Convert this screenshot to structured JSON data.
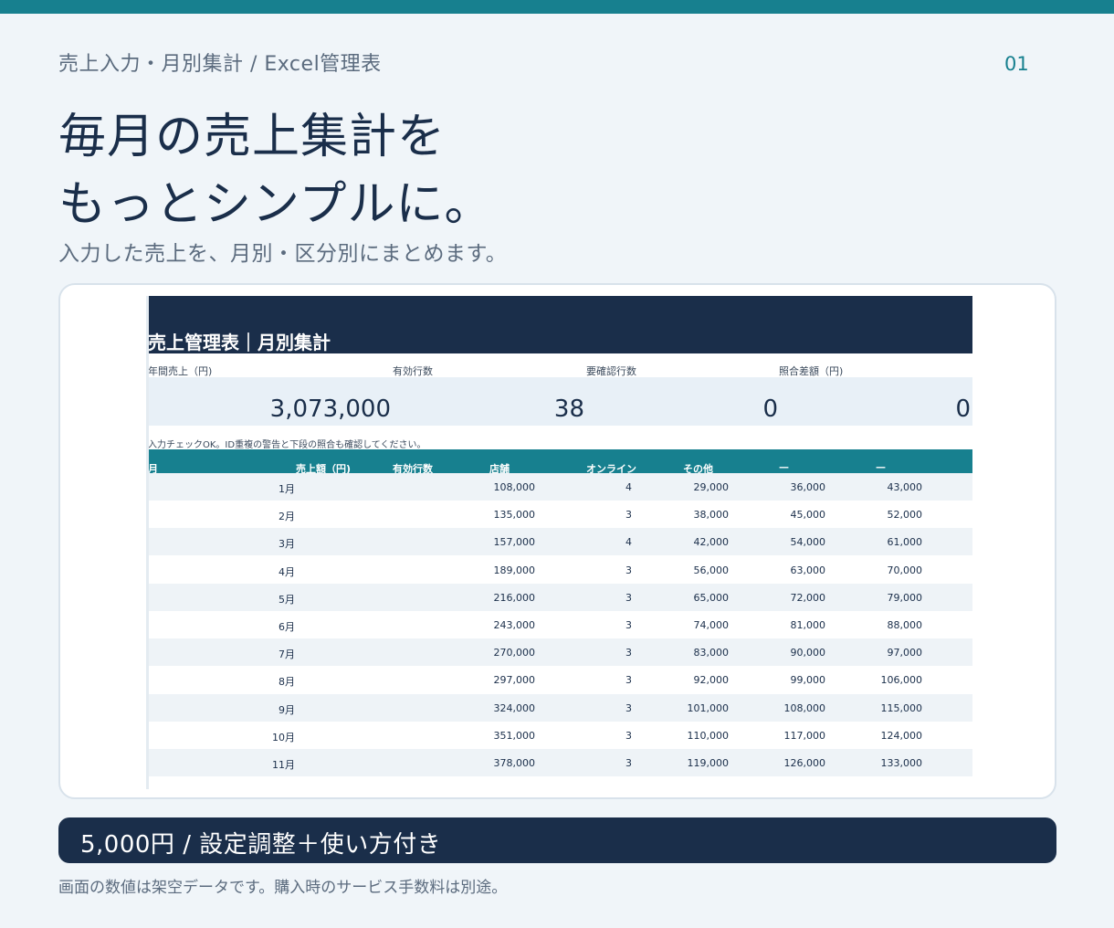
{
  "breadcrumb": "売上入力・月別集計 / Excel管理表",
  "page_number": "01",
  "headline": [
    "毎月の売上集計を",
    "もっとシンプルに。"
  ],
  "subline": "入力した売上を、月別・区分別にまとめます。",
  "sheet": {
    "title": "売上管理表｜月別集計",
    "kpis": [
      {
        "label": "年間売上（円)",
        "value": "3,073,000"
      },
      {
        "label": "有効行数",
        "value": "38"
      },
      {
        "label": "要確認行数",
        "value": "0"
      },
      {
        "label": "照合差額（円)",
        "value": "0"
      }
    ],
    "note": "入力チェックOK。ID重複の警告と下段の照合も確認してください。",
    "columns": [
      "月",
      "売上額（円)",
      "有効行数",
      "店舗",
      "オンライン",
      "その他",
      "—",
      "—"
    ],
    "rows": [
      [
        "1月",
        "108,000",
        "4",
        "29,000",
        "36,000",
        "43,000"
      ],
      [
        "2月",
        "135,000",
        "3",
        "38,000",
        "45,000",
        "52,000"
      ],
      [
        "3月",
        "157,000",
        "4",
        "42,000",
        "54,000",
        "61,000"
      ],
      [
        "4月",
        "189,000",
        "3",
        "56,000",
        "63,000",
        "70,000"
      ],
      [
        "5月",
        "216,000",
        "3",
        "65,000",
        "72,000",
        "79,000"
      ],
      [
        "6月",
        "243,000",
        "3",
        "74,000",
        "81,000",
        "88,000"
      ],
      [
        "7月",
        "270,000",
        "3",
        "83,000",
        "90,000",
        "97,000"
      ],
      [
        "8月",
        "297,000",
        "3",
        "92,000",
        "99,000",
        "106,000"
      ],
      [
        "9月",
        "324,000",
        "3",
        "101,000",
        "108,000",
        "115,000"
      ],
      [
        "10月",
        "351,000",
        "3",
        "110,000",
        "117,000",
        "124,000"
      ],
      [
        "11月",
        "378,000",
        "3",
        "119,000",
        "126,000",
        "133,000"
      ]
    ]
  },
  "price": "5,000円 / 設定調整＋使い方付き",
  "footnote": "画面の数値は架空データです。購入時のサービス手数料は別途。",
  "colors": {
    "accent": "#17808f",
    "navy": "#1a2e4a",
    "background": "#f0f5f9"
  }
}
